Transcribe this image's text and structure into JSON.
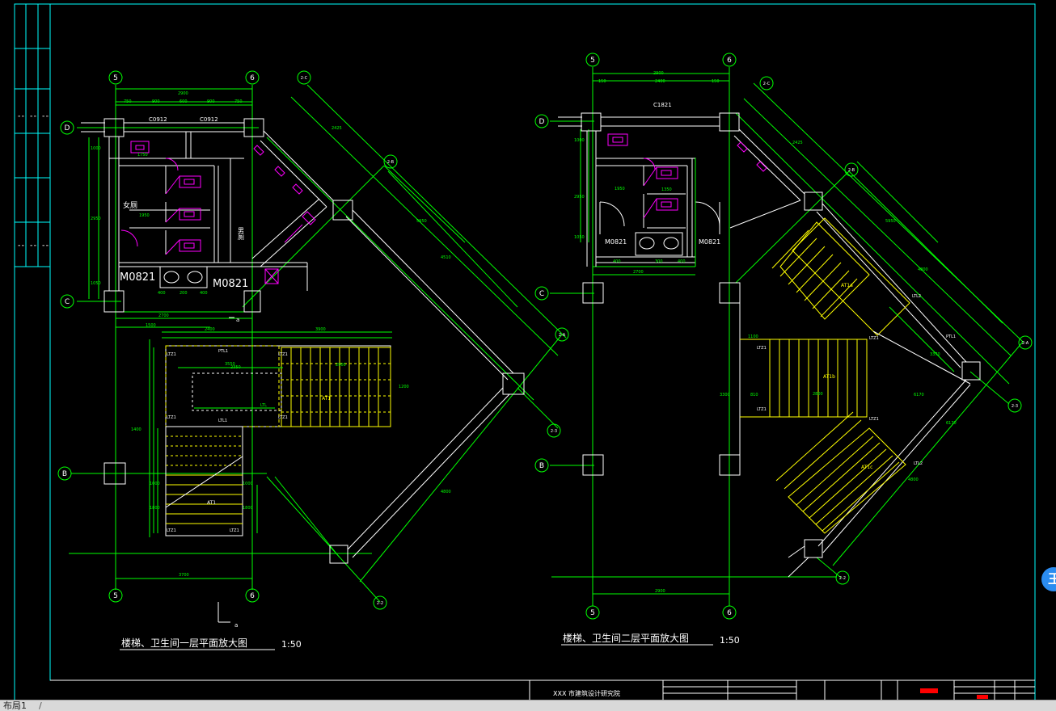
{
  "colors": {
    "background": "#000000",
    "frame": "#00ffff",
    "grid": "#00ff00",
    "wall": "#ffffff",
    "stairs": "#ffff00",
    "fixtures": "#ff00ff",
    "dims": "#00ff00"
  },
  "plan1": {
    "title": "楼梯、卫生间一层平面放大图",
    "scale": "1:50",
    "axis_top_left": "5",
    "axis_top_right": "6",
    "axis_bottom_left": "5",
    "axis_bottom_right": "6",
    "axis_d": "D",
    "axis_c": "C",
    "axis_b": "B",
    "axis_2c": "2-C",
    "axis_2b": "2-B",
    "axis_2a": "2-A",
    "axis_22": "2-2",
    "axis_23": "2-3",
    "door_left": "M0821",
    "door_right": "M0821",
    "window_left": "C0912",
    "window_right": "C0912",
    "room_female": "女厕",
    "room_male": "男厕",
    "dim_top_total": "2900",
    "dim_top_parts": [
      "750",
      "900",
      "600",
      "900",
      "750"
    ],
    "dim_mid_2400": "2400",
    "dim_mid_3900": "3900",
    "dim_bottom": "3700",
    "dim_2700": "2700",
    "dim_2900": "2900",
    "dim_3550": "3550",
    "stair_label": "AT1",
    "beam_ptl1": "PTL1",
    "beam_ltl1": "LTL1",
    "col_ltz1": "LTZ1",
    "section_mark": "a"
  },
  "plan2": {
    "title": "楼梯、卫生间二层平面放大图",
    "scale": "1:50",
    "axis_top_left": "5",
    "axis_top_right": "6",
    "axis_bottom_left": "5",
    "axis_bottom_right": "6",
    "axis_d": "D",
    "axis_c": "C",
    "axis_b": "B",
    "axis_2c": "2-C",
    "axis_2b": "2-B",
    "axis_2a": "2-A",
    "axis_22": "2-2",
    "axis_23": "2-3",
    "window_top": "C1821",
    "door_left": "M0821",
    "door_right": "M0821",
    "dim_top_total": "2900",
    "dim_top_parts": [
      "150",
      "2400",
      "150"
    ],
    "dim_bottom": "2900",
    "dim_2700": "2700",
    "stair_at1a": "AT1a",
    "stair_at1b": "AT1b",
    "stair_at1c": "AT1c",
    "beam_ltl2": "LTL2",
    "beam_ptl1": "PTL1",
    "col_ltz1": "LTZ1"
  },
  "title_block": {
    "company": "XXX 市建筑设计研究院"
  },
  "status": {
    "layout_tab": "布局1",
    "separator": "/"
  },
  "side_button_label": "王"
}
